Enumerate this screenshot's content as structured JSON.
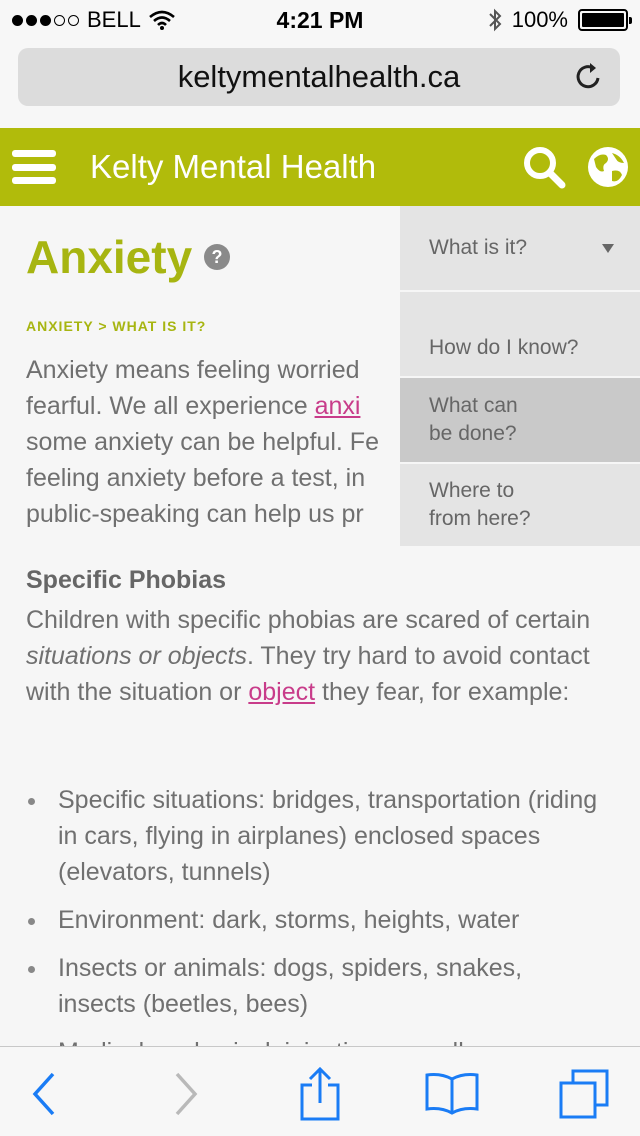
{
  "status": {
    "carrier": "BELL",
    "time": "4:21 PM",
    "battery": "100%",
    "battery_level": 1.0,
    "signal_bars": 3
  },
  "browser": {
    "url": "keltymentalhealth.ca"
  },
  "site": {
    "title": "Kelty Mental Health",
    "brand_color": "#b1bb0b"
  },
  "page": {
    "title": "Anxiety",
    "breadcrumb": "ANXIETY > WHAT IS IT?",
    "intro_text_1": "Anxiety means feeling worried",
    "intro_text_2": "fearful. We all experience ",
    "intro_link": "anxi",
    "intro_text_3": "some anxiety can be helpful. Fe",
    "intro_text_4": "feeling anxiety before a test, in",
    "intro_text_5": "public-speaking can help us pr",
    "section_title": "Specific Phobias",
    "section_text_1": "Children with specific phobias are scared of certain ",
    "section_text_italic": "situations or objects",
    "section_text_2": ". They try hard to avoid contact with the situation or ",
    "section_link": "object",
    "section_text_3": " they fear, for example:",
    "bullets": [
      "Specific situations: bridges, transportation (riding in cars, flying in airplanes) enclosed spaces (elevators, tunnels)",
      "Environment: dark, storms, heights, water",
      "Insects or animals: dogs, spiders, snakes, insects (beetles, bees)",
      "Medical or physical: injections, needles"
    ]
  },
  "side_menu": {
    "items": [
      {
        "label": "What is it?"
      },
      {
        "label": "How do I know?"
      },
      {
        "label": "What can\nbe done?"
      },
      {
        "label": "Where to\nfrom here?"
      }
    ]
  }
}
